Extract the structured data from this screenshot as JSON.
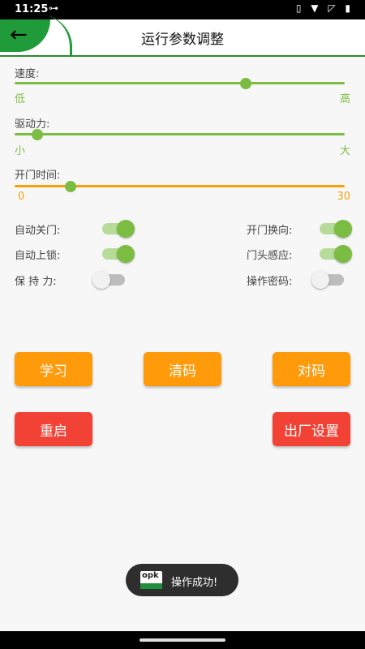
{
  "status_bar": {
    "time": "11:25",
    "key_glyph": "⊶",
    "right_glyphs": "▯ ▼ ◸ ▮"
  },
  "header": {
    "back_glyph": "←",
    "title": "运行参数调整"
  },
  "sliders": {
    "speed": {
      "label": "速度:",
      "min_label": "低",
      "max_label": "高",
      "level_fraction": 0.7,
      "color": "#7bbd42"
    },
    "drive": {
      "label": "驱动力:",
      "min_label": "小",
      "max_label": "大",
      "level_fraction": 0.07,
      "color": "#7bbd42"
    },
    "open_time": {
      "label": "开门时间:",
      "min_label": "0",
      "max_label": "30",
      "level_fraction": 0.17,
      "color": "#f5a20a",
      "thumb_color": "#7bbd42"
    }
  },
  "toggles": {
    "auto_close": {
      "label": "自动关门:",
      "on": true
    },
    "door_direction": {
      "label": "开门换向:",
      "on": true
    },
    "auto_lock": {
      "label": "自动上锁:",
      "on": true
    },
    "head_sensor": {
      "label": "门头感应:",
      "on": true
    },
    "hold_force": {
      "label": "保 持 力:",
      "on": false
    },
    "op_password": {
      "label": "操作密码:",
      "on": false
    }
  },
  "buttons": {
    "learn": "学习",
    "clear_code": "清码",
    "pair_code": "对码",
    "restart": "重启",
    "factory_settings": "出厂设置"
  },
  "toast": {
    "logo_text": "opk",
    "message": "操作成功!"
  },
  "colors": {
    "accent_green": "#7bbd42",
    "header_green": "#1f9b3a",
    "orange": "#ff9a0a",
    "red": "#f24236"
  }
}
